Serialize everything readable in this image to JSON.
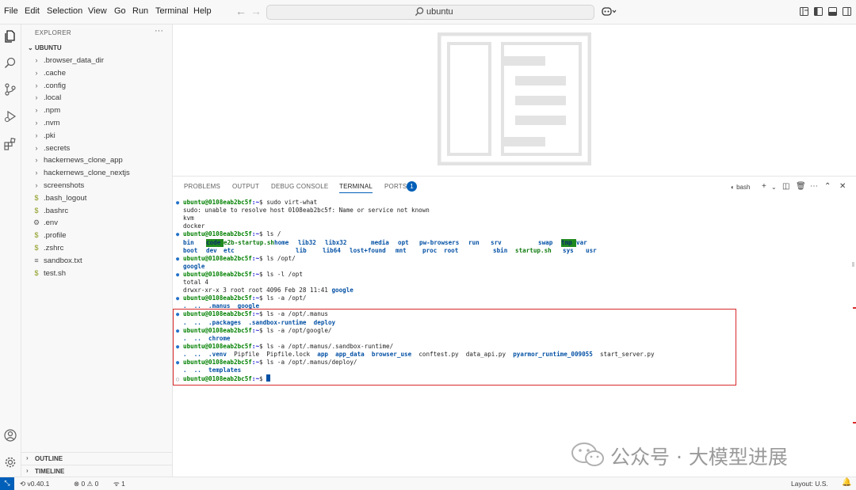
{
  "menubar": {
    "items": [
      "File",
      "Edit",
      "Selection",
      "View",
      "Go",
      "Run",
      "Terminal",
      "Help"
    ],
    "search": "ubuntu"
  },
  "explorer": {
    "title": "EXPLORER",
    "more": "···",
    "workspace": "UBUNTU",
    "items": [
      {
        "icon": "chevron-right-icon",
        "glyph": "›",
        "label": ".browser_data_dir"
      },
      {
        "icon": "chevron-right-icon",
        "glyph": "›",
        "label": ".cache"
      },
      {
        "icon": "chevron-right-icon",
        "glyph": "›",
        "label": ".config"
      },
      {
        "icon": "chevron-right-icon",
        "glyph": "›",
        "label": ".local"
      },
      {
        "icon": "chevron-right-icon",
        "glyph": "›",
        "label": ".npm"
      },
      {
        "icon": "chevron-right-icon",
        "glyph": "›",
        "label": ".nvm"
      },
      {
        "icon": "chevron-right-icon",
        "glyph": "›",
        "label": ".pki"
      },
      {
        "icon": "chevron-right-icon",
        "glyph": "›",
        "label": ".secrets"
      },
      {
        "icon": "chevron-right-icon",
        "glyph": "›",
        "label": "hackernews_clone_app"
      },
      {
        "icon": "chevron-right-icon",
        "glyph": "›",
        "label": "hackernews_clone_nextjs"
      },
      {
        "icon": "chevron-right-icon",
        "glyph": "›",
        "label": "screenshots"
      },
      {
        "icon": "shell-file-icon",
        "glyph": "$",
        "label": ".bash_logout"
      },
      {
        "icon": "shell-file-icon",
        "glyph": "$",
        "label": ".bashrc"
      },
      {
        "icon": "gear-file-icon",
        "glyph": "⚙",
        "label": ".env"
      },
      {
        "icon": "shell-file-icon",
        "glyph": "$",
        "label": ".profile"
      },
      {
        "icon": "shell-file-icon",
        "glyph": "$",
        "label": ".zshrc"
      },
      {
        "icon": "text-file-icon",
        "glyph": "≡",
        "label": "sandbox.txt"
      },
      {
        "icon": "shell-file-icon",
        "glyph": "$",
        "label": "test.sh"
      }
    ],
    "outline": "OUTLINE",
    "timeline": "TIMELINE"
  },
  "panel": {
    "tabs": [
      "PROBLEMS",
      "OUTPUT",
      "DEBUG CONSOLE",
      "TERMINAL",
      "PORTS"
    ],
    "ports_badge": "1",
    "shell": "bash"
  },
  "terminal": {
    "prompt_user": "ubuntu@0108eab2bc5f",
    "prompt_path": ":~",
    "lines": {
      "l1_cmd": "sudo virt-what",
      "l2": "sudo: unable to resolve host 0108eab2bc5f: Name or service not known",
      "l3": "kvm",
      "l4": "docker",
      "l5_cmd": "ls /",
      "l8_cmd": "ls /opt/",
      "l9": "google",
      "l10_cmd": "ls -l /opt",
      "l11": "total 4",
      "l12_pre": "drwxr-xr-x 3 root root 4096 Feb 28 11:41 ",
      "l12_dir": "google",
      "l13_cmd": "ls -a /opt/",
      "l15_cmd": "ls -a /opt/.manus",
      "l17_cmd": "ls -a /opt/google/",
      "l19_cmd": "ls -a /opt/.manus/.sandbox-runtime/",
      "l21_cmd": "ls -a /opt/.manus/deploy/"
    },
    "dotdirs": [
      ".",
      ".."
    ],
    "root_row1": [
      {
        "t": "bin",
        "c": "dir"
      },
      {
        "t": "code",
        "c": "hl"
      },
      {
        "t": "e2b-startup.sh",
        "c": "exe"
      },
      {
        "t": "home",
        "c": "dir"
      },
      {
        "t": "lib32",
        "c": "dir"
      },
      {
        "t": "libx32",
        "c": "dir"
      },
      {
        "t": "media",
        "c": "dir"
      },
      {
        "t": "opt",
        "c": "dir"
      },
      {
        "t": "pw-browsers",
        "c": "dir"
      },
      {
        "t": "run",
        "c": "dir"
      },
      {
        "t": "srv",
        "c": "dir"
      },
      {
        "t": "swap",
        "c": "dir"
      },
      {
        "t": "tmp",
        "c": "hl"
      },
      {
        "t": "var",
        "c": "dir"
      }
    ],
    "root_row2": [
      {
        "t": "boot",
        "c": "dir"
      },
      {
        "t": "dev",
        "c": "dir"
      },
      {
        "t": "etc",
        "c": "dir"
      },
      {
        "t": "lib",
        "c": "dir"
      },
      {
        "t": "lib64",
        "c": "dir"
      },
      {
        "t": "lost+found",
        "c": "dir"
      },
      {
        "t": "mnt",
        "c": "dir"
      },
      {
        "t": "proc",
        "c": "dir"
      },
      {
        "t": "root",
        "c": "dir"
      },
      {
        "t": "sbin",
        "c": "dir"
      },
      {
        "t": "startup.sh",
        "c": "exe"
      },
      {
        "t": "sys",
        "c": "dir"
      },
      {
        "t": "usr",
        "c": "dir"
      }
    ],
    "opt_list": [
      ".manus",
      "google"
    ],
    "manus_list": [
      ".packages",
      ".sandbox-runtime",
      "deploy"
    ],
    "google_list": [
      "chrome"
    ],
    "runtime_list": [
      {
        "t": ".venv",
        "c": "dir"
      },
      {
        "t": "Pipfile",
        "c": "plain"
      },
      {
        "t": "Pipfile.lock",
        "c": "plain"
      },
      {
        "t": "app",
        "c": "dir"
      },
      {
        "t": "app_data",
        "c": "dir"
      },
      {
        "t": "browser_use",
        "c": "dir"
      },
      {
        "t": "conftest.py",
        "c": "plain"
      },
      {
        "t": "data_api.py",
        "c": "plain"
      },
      {
        "t": "pyarmor_runtime_009055",
        "c": "dir"
      },
      {
        "t": "start_server.py",
        "c": "plain"
      }
    ],
    "deploy_list": [
      "templates"
    ]
  },
  "watermark": "公众号 · 大模型进展",
  "statusbar": {
    "version": "v0.40.1",
    "errors": "0",
    "warnings": "0",
    "ports": "1",
    "layout": "Layout: U.S."
  },
  "colors": {
    "accent": "#005fb8",
    "highlight_box": "#d72a2a",
    "prompt_green": "#008000",
    "dir_blue": "#0451a5"
  }
}
